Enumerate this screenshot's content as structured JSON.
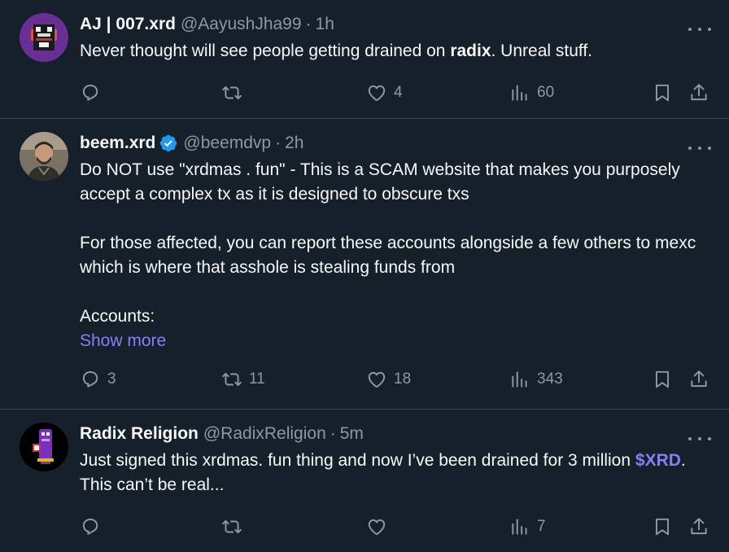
{
  "tweets": [
    {
      "display_name": "AJ | 007.xrd",
      "handle": "@AayushJha99",
      "separator": "·",
      "time": "1h",
      "verified": false,
      "text_segments": [
        {
          "text": "Never thought will see people getting drained on "
        },
        {
          "text": "radix",
          "style": "bold"
        },
        {
          "text": ". Unreal stuff."
        }
      ],
      "counts": {
        "replies": "",
        "retweets": "",
        "likes": "4",
        "views": "60"
      }
    },
    {
      "display_name": "beem.xrd",
      "handle": "@beemdvp",
      "separator": "·",
      "time": "2h",
      "verified": true,
      "paragraphs": [
        "Do NOT use \"xrdmas . fun\" - This is a SCAM website that makes you purposely accept a complex tx as it is designed to obscure txs",
        "For those affected, you can report these accounts alongside a few others to mexc which is where that asshole is stealing funds from",
        "Accounts:"
      ],
      "show_more": "Show more",
      "counts": {
        "replies": "3",
        "retweets": "11",
        "likes": "18",
        "views": "343"
      }
    },
    {
      "display_name": "Radix Religion",
      "handle": "@RadixReligion",
      "separator": "·",
      "time": "5m",
      "verified": false,
      "text_segments": [
        {
          "text": "Just signed this xrdmas. fun thing and now I’ve been drained for 3 million "
        },
        {
          "text": "$XRD",
          "style": "cashtag"
        },
        {
          "text": ". This can’t be real..."
        }
      ],
      "counts": {
        "replies": "",
        "retweets": "",
        "likes": "",
        "views": "7"
      }
    }
  ],
  "colors": {
    "background": "#15202b",
    "divider": "#38444d",
    "secondary_text": "#8b98a5",
    "link_accent": "#8b7cf6",
    "verified_badge": "#1d9bf0"
  },
  "icons": [
    "more-icon",
    "reply-icon",
    "retweet-icon",
    "like-icon",
    "views-icon",
    "bookmark-icon",
    "share-icon",
    "verified-icon"
  ]
}
